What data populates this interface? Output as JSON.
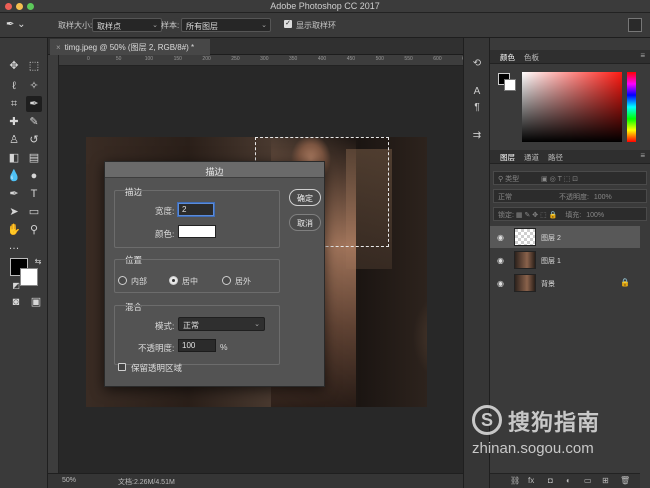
{
  "app": {
    "title": "Adobe Photoshop CC 2017"
  },
  "options_bar": {
    "sample_size_label": "取样大小:",
    "sample_size_value": "取样点",
    "sample_label": "样本:",
    "sample_value": "所有图层",
    "show_ring_label": "显示取样环"
  },
  "document": {
    "tab_title": "timg.jpeg @ 50% (图层 2, RGB/8#) *",
    "zoom": "50%",
    "doc_info": "文档:2.26M/4.51M"
  },
  "ruler": {
    "ticks": [
      "0",
      "50",
      "100",
      "150",
      "200",
      "250",
      "300",
      "350",
      "400",
      "450",
      "500",
      "550",
      "600",
      "650"
    ]
  },
  "panels": {
    "color_tabs": [
      "颜色",
      "色板"
    ],
    "layers_tabs": [
      "图层",
      "通道",
      "路径"
    ],
    "filter_placeholder": "类型",
    "blend_mode": "正常",
    "opacity_label": "不透明度:",
    "opacity_value": "100%",
    "lock_label": "锁定:",
    "fill_label": "填充:",
    "fill_value": "100%",
    "layers": [
      {
        "name": "图层 2",
        "selected": true
      },
      {
        "name": "图层 1",
        "selected": false
      },
      {
        "name": "背景",
        "selected": false,
        "locked": true
      }
    ]
  },
  "dialog": {
    "title": "描边",
    "stroke_group": "描边",
    "width_label": "宽度:",
    "width_value": "2",
    "color_label": "颜色:",
    "color_value": "#ffffff",
    "position_group": "位置",
    "positions": [
      "内部",
      "居中",
      "居外"
    ],
    "selected_position": "居中",
    "blend_group": "混合",
    "mode_label": "模式:",
    "mode_value": "正常",
    "opacity_label": "不透明度:",
    "opacity_value": "100",
    "opacity_unit": "%",
    "preserve_label": "保留透明区域",
    "ok_label": "确定",
    "cancel_label": "取消"
  },
  "watermark": {
    "logo_letter": "S",
    "brand": "搜狗指南",
    "url": "zhinan.sogou.com"
  }
}
